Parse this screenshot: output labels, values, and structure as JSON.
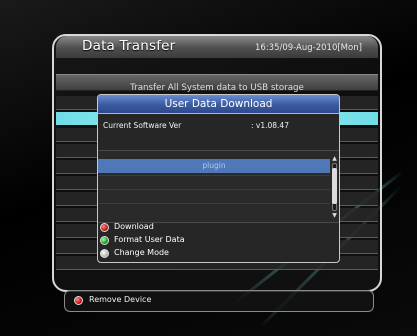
{
  "screen": {
    "title": "Data Transfer",
    "datetime": "16:35/09-Aug-2010[Mon]",
    "subheader": "Transfer All System data to USB storage"
  },
  "dialog": {
    "title": "User Data Download",
    "software_label": "Current Software Ver",
    "software_value": ": v1.08.47",
    "list": {
      "items": [
        {
          "label": "plugin",
          "selected": true
        }
      ],
      "scroll_up_icon": "up-arrow-icon",
      "scroll_down_icon": "down-arrow-icon"
    },
    "keys": [
      {
        "color": "red",
        "color_hex": "#d22020",
        "label": "Download"
      },
      {
        "color": "green",
        "color_hex": "#22b02a",
        "label": "Format User Data"
      },
      {
        "color": "white",
        "color_hex": "#e6e6e6",
        "label": "Change Mode"
      }
    ]
  },
  "footer": {
    "key_color": "red",
    "key_color_hex": "#d22020",
    "label": "Remove Device"
  },
  "colors": {
    "dialog_title_bg": "#3c5aa0",
    "selection": "#4f78b8",
    "highlight_row": "#8ee8ee"
  }
}
